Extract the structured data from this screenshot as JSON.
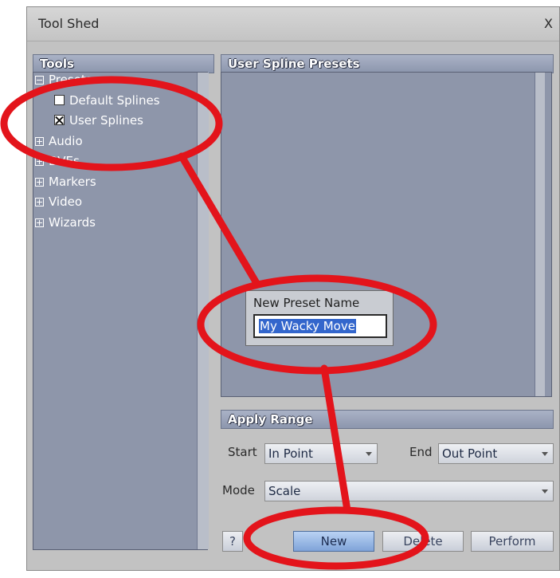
{
  "window": {
    "title": "Tool Shed",
    "close_label": "X"
  },
  "tools_panel": {
    "header": "Tools",
    "items": [
      {
        "label": "Presets",
        "kind": "collapse"
      },
      {
        "label": "Default Splines",
        "kind": "checkbox",
        "checked": false
      },
      {
        "label": "User Splines",
        "kind": "checkbox",
        "checked": true
      },
      {
        "label": "Audio",
        "kind": "expand"
      },
      {
        "label": "DVEs",
        "kind": "expand"
      },
      {
        "label": "Markers",
        "kind": "expand"
      },
      {
        "label": "Video",
        "kind": "expand"
      },
      {
        "label": "Wizards",
        "kind": "expand"
      }
    ]
  },
  "presets_panel": {
    "header": "User Spline Presets"
  },
  "new_preset_dialog": {
    "label": "New Preset Name",
    "value": "My Wacky Move"
  },
  "apply_range": {
    "header": "Apply Range",
    "start_label": "Start",
    "start_value": "In Point",
    "end_label": "End",
    "end_value": "Out Point",
    "mode_label": "Mode",
    "mode_value": "Scale"
  },
  "buttons": {
    "help": "?",
    "new": "New",
    "delete": "Delete",
    "perform": "Perform"
  },
  "colors": {
    "annotation": "#e3141b",
    "accent": "#8e96aa",
    "selection": "#3366cc"
  }
}
